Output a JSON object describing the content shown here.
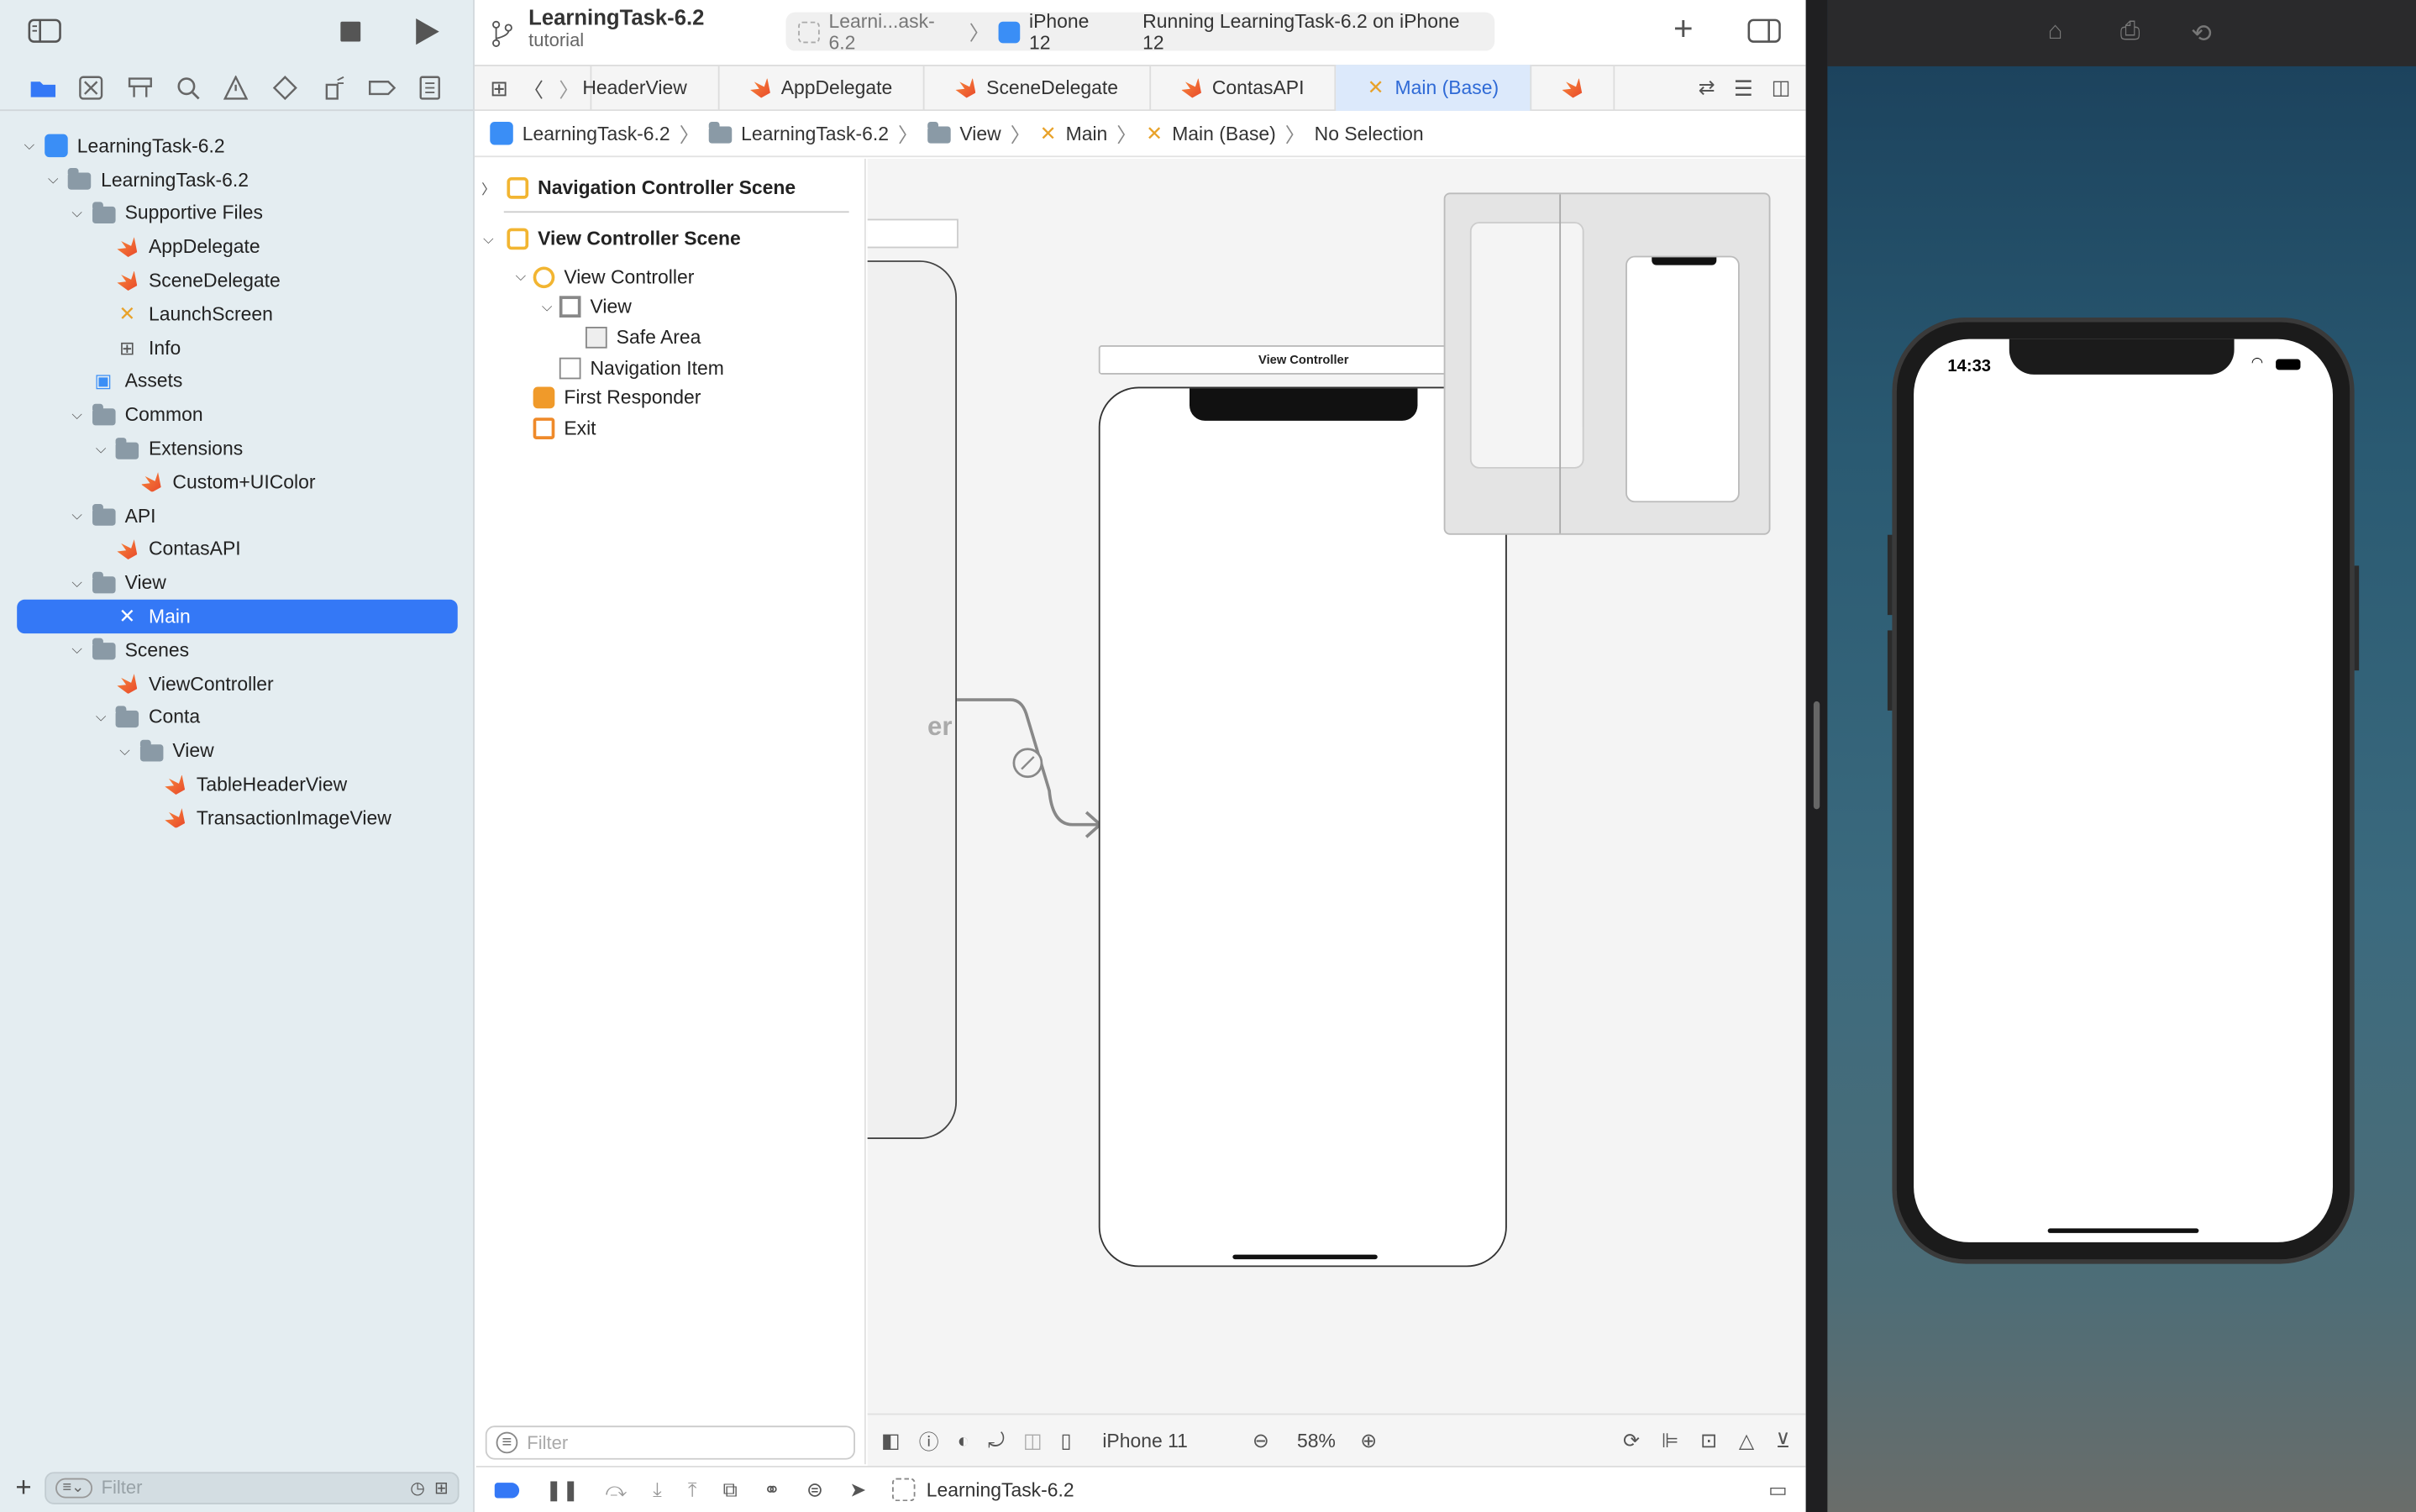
{
  "project": {
    "title": "LearningTask-6.2",
    "subtitle": "tutorial"
  },
  "scheme": {
    "target": "Learni...ask-6.2",
    "device": "iPhone 12",
    "status": "Running LearningTask-6.2 on iPhone 12"
  },
  "navigator": {
    "tree": [
      {
        "label": "LearningTask-6.2",
        "icon": "xcodeproj-icon",
        "level": 0,
        "expanded": true
      },
      {
        "label": "LearningTask-6.2",
        "icon": "folder-icon",
        "level": 1,
        "expanded": true
      },
      {
        "label": "Supportive Files",
        "icon": "folder-icon",
        "level": 2,
        "expanded": true
      },
      {
        "label": "AppDelegate",
        "icon": "swift-file-icon",
        "level": 3
      },
      {
        "label": "SceneDelegate",
        "icon": "swift-file-icon",
        "level": 3
      },
      {
        "label": "LaunchScreen",
        "icon": "storyboard-icon",
        "level": 3
      },
      {
        "label": "Info",
        "icon": "plist-icon",
        "level": 3
      },
      {
        "label": "Assets",
        "icon": "assets-icon",
        "level": 2
      },
      {
        "label": "Common",
        "icon": "folder-icon",
        "level": 2,
        "expanded": true
      },
      {
        "label": "Extensions",
        "icon": "folder-icon",
        "level": 3,
        "expanded": true
      },
      {
        "label": "Custom+UIColor",
        "icon": "swift-file-icon",
        "level": 4
      },
      {
        "label": "API",
        "icon": "folder-icon",
        "level": 2,
        "expanded": true
      },
      {
        "label": "ContasAPI",
        "icon": "swift-file-icon",
        "level": 3
      },
      {
        "label": "View",
        "icon": "folder-icon",
        "level": 2,
        "expanded": true
      },
      {
        "label": "Main",
        "icon": "storyboard-icon",
        "level": 3,
        "selected": true
      },
      {
        "label": "Scenes",
        "icon": "folder-icon",
        "level": 2,
        "expanded": true
      },
      {
        "label": "ViewController",
        "icon": "swift-file-icon",
        "level": 3
      },
      {
        "label": "Conta",
        "icon": "folder-icon",
        "level": 3,
        "expanded": true
      },
      {
        "label": "View",
        "icon": "folder-icon",
        "level": 4,
        "expanded": true
      },
      {
        "label": "TableHeaderView",
        "icon": "swift-file-icon",
        "level": 5
      },
      {
        "label": "TransactionImageView",
        "icon": "swift-file-icon",
        "level": 5
      }
    ],
    "filter_placeholder": "Filter"
  },
  "tabs": [
    {
      "label": "HeaderView",
      "icon": "swift-file-icon"
    },
    {
      "label": "AppDelegate",
      "icon": "swift-file-icon"
    },
    {
      "label": "SceneDelegate",
      "icon": "swift-file-icon"
    },
    {
      "label": "ContasAPI",
      "icon": "swift-file-icon"
    },
    {
      "label": "Main (Base)",
      "icon": "storyboard-icon",
      "active": true
    }
  ],
  "jumpbar": [
    "LearningTask-6.2",
    "LearningTask-6.2",
    "View",
    "Main",
    "Main (Base)",
    "No Selection"
  ],
  "outline": {
    "scenes": [
      {
        "label": "Navigation Controller Scene",
        "expanded": false
      },
      {
        "label": "View Controller Scene",
        "expanded": true
      }
    ],
    "items": [
      {
        "label": "View Controller",
        "icon": "view-controller-icon",
        "level": 1,
        "expanded": true
      },
      {
        "label": "View",
        "icon": "view-icon",
        "level": 2,
        "expanded": true
      },
      {
        "label": "Safe Area",
        "icon": "safe-area-icon",
        "level": 3
      },
      {
        "label": "Navigation Item",
        "icon": "navigation-item-icon",
        "level": 2
      },
      {
        "label": "First Responder",
        "icon": "first-responder-icon",
        "level": 1
      },
      {
        "label": "Exit",
        "icon": "exit-icon",
        "level": 1
      }
    ],
    "filter_placeholder": "Filter"
  },
  "canvas": {
    "scene_title": "View Controller",
    "nav_partial_label": "er",
    "device": "iPhone 11",
    "zoom": "58%"
  },
  "debug": {
    "target": "LearningTask-6.2"
  },
  "simulator": {
    "time": "14:33"
  },
  "colors": {
    "accent": "#3478f6",
    "swift": "#e8482b",
    "storyboard": "#e8a22a"
  }
}
